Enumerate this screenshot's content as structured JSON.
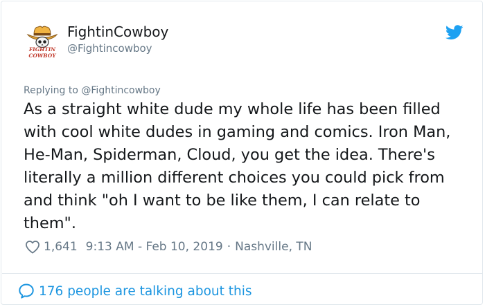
{
  "author": {
    "display_name": "FightinCowboy",
    "handle": "@Fightincowboy",
    "avatar_text": "FIGHTIN COWBOY"
  },
  "reply": {
    "prefix": "Replying to",
    "to_handle": "@Fightincowboy"
  },
  "tweet": {
    "text": "As a straight white dude my whole life has been filled with cool white dudes in gaming and comics. Iron Man, He-Man, Spiderman, Cloud, you get the idea. There's literally a million different choices you could pick from and think \"oh I want to be like them, I can relate to them\"."
  },
  "meta": {
    "likes": "1,641",
    "timestamp": "9:13 AM - Feb 10, 2019",
    "separator": "·",
    "location": "Nashville, TN"
  },
  "footer": {
    "talking": "176 people are talking about this"
  },
  "colors": {
    "link": "#1b95e0",
    "secondary": "#657786",
    "border": "#e1e8ed",
    "logo_red": "#c0392b"
  },
  "icons": {
    "brand": "twitter-bird-icon",
    "like": "heart-icon",
    "replies": "speech-bubble-icon"
  }
}
